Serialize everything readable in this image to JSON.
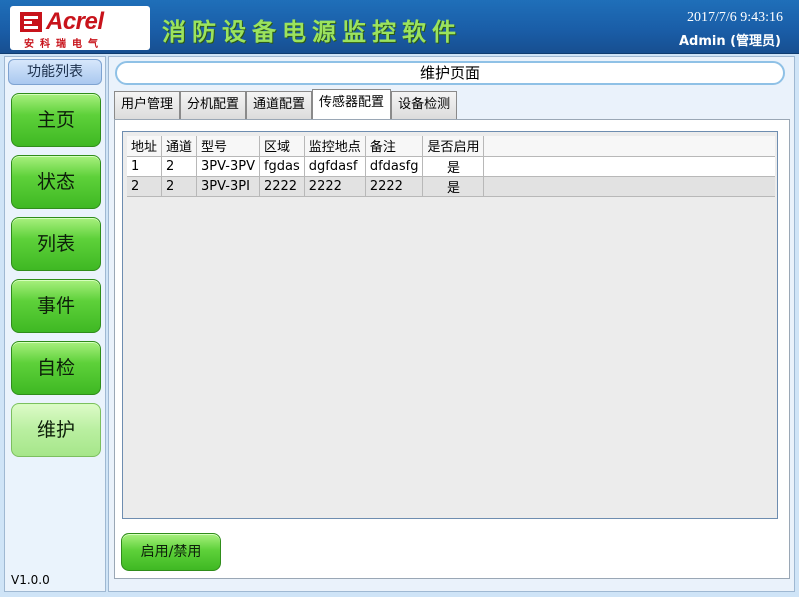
{
  "header": {
    "logo_text": "Acrel",
    "logo_sub": "安科瑞电气",
    "app_title": "消防设备电源监控软件",
    "datetime": "2017/7/6 9:43:16",
    "user": "Admin (管理员)"
  },
  "sidebar": {
    "header": "功能列表",
    "items": [
      {
        "label": "主页",
        "active": false
      },
      {
        "label": "状态",
        "active": false
      },
      {
        "label": "列表",
        "active": false
      },
      {
        "label": "事件",
        "active": false
      },
      {
        "label": "自检",
        "active": false
      },
      {
        "label": "维护",
        "active": true
      }
    ],
    "version": "V1.0.0"
  },
  "main": {
    "page_title": "维护页面",
    "tabs": [
      {
        "label": "用户管理",
        "active": false
      },
      {
        "label": "分机配置",
        "active": false
      },
      {
        "label": "通道配置",
        "active": false
      },
      {
        "label": "传感器配置",
        "active": true
      },
      {
        "label": "设备检测",
        "active": false
      }
    ],
    "table": {
      "columns": [
        "地址",
        "通道",
        "型号",
        "区域",
        "监控地点",
        "备注",
        "是否启用"
      ],
      "rows": [
        [
          "1",
          "2",
          "3PV-3PV",
          "fgdas",
          "dgfdasf",
          "dfdasfg",
          "是"
        ],
        [
          "2",
          "2",
          "3PV-3PI",
          "2222",
          "2222",
          "2222",
          "是"
        ]
      ]
    },
    "action_button": "启用/禁用"
  },
  "colors": {
    "header_blue": "#1a5ea8",
    "title_green": "#9be35e",
    "button_green": "#5ed13a",
    "logo_red": "#c8131b"
  }
}
